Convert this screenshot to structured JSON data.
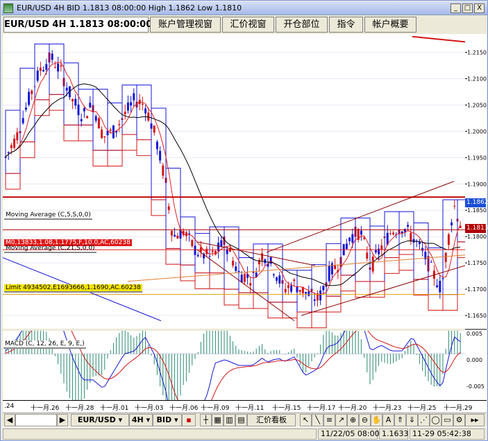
{
  "window": {
    "title": "EUR/USD 4H BID 1.1813 08:00:00 High 1.1862 Low 1.1810",
    "min_label": "_",
    "max_label": "□",
    "close_label": "X"
  },
  "tabs": [
    {
      "label": "EUR/USD 4H 1.1813 08:00:00"
    },
    {
      "label": "账户管理视窗"
    },
    {
      "label": "汇价视窗"
    },
    {
      "label": "开仓部位"
    },
    {
      "label": "指令"
    },
    {
      "label": "帐户概要"
    }
  ],
  "price_axis": {
    "ticks": [
      "1.2150",
      "1.2100",
      "1.2050",
      "1.2000",
      "1.1950",
      "1.1900",
      "1.1850",
      "1.1800",
      "1.1750",
      "1.1700",
      "1.1650"
    ],
    "tick_values": [
      1.215,
      1.21,
      1.205,
      1.2,
      1.195,
      1.19,
      1.185,
      1.18,
      1.175,
      1.17,
      1.165
    ],
    "high_box": "1.1862",
    "current_box": "1.1813",
    "high_color": "#1a4fd6",
    "current_color": "#b00000"
  },
  "macd_axis": {
    "ticks": [
      "0.005",
      "0.000",
      "-0.005"
    ],
    "label": "MACD (C, 12, 26, E, 9, E,)"
  },
  "indicator_labels": {
    "ma5": "Moving Average (C,5,S,0,0)",
    "ma21": "Moving Average (C,21,S,0,0)",
    "stop": "M0,13833,1.08,1.1775,F,10.0,AC,60238",
    "limit": "Limit 4934502,E1693666,1.1690,AC.60238"
  },
  "x_axis": {
    "labels": [
      ".24",
      "十一月.26",
      "十一月.28",
      "十一月.01",
      "十一月.03",
      "十一月.06",
      "十一月.09",
      "十一月.11",
      "十一月.15",
      "十一月.17",
      "十一月.20",
      "十一月.23",
      "十一月.25",
      "十一月.29"
    ]
  },
  "bottom_toolbar": {
    "symbol": "EUR/USD",
    "timeframe": "4H",
    "price_type": "BID",
    "quote_view": "汇价看板"
  },
  "status": {
    "left": "11/22/05 08:00",
    "price": "1.1633",
    "right": "11-29 05:42:38"
  },
  "colors": {
    "up": "#1515d4",
    "down": "#d41515",
    "ma5": "#e02020",
    "ma21": "#000000",
    "channel": "#c00000"
  },
  "chart_data": {
    "type": "candlestick",
    "title": "EUR/USD 4H",
    "ylim": [
      1.1625,
      1.2185
    ],
    "macd_ylim": [
      -0.008,
      0.004
    ]
  }
}
